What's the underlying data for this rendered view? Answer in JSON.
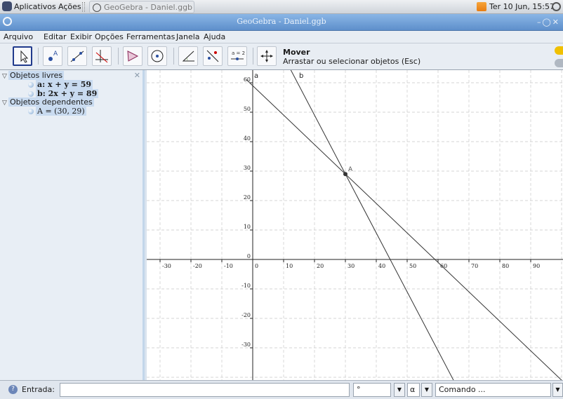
{
  "system_bar": {
    "menu_apps": "Aplicativos",
    "menu_actions": "Ações",
    "task_title": "GeoGebra - Daniel.ggb",
    "clock": "Ter 10 Jun, 15:57"
  },
  "window": {
    "title": "GeoGebra - Daniel.ggb"
  },
  "menu": [
    "Arquivo",
    "Editar",
    "Exibir",
    "Opções",
    "Ferramentas",
    "Janela",
    "Ajuda"
  ],
  "toolbar": {
    "mode_title": "Mover",
    "mode_description": "Arrastar ou selecionar objetos (Esc)",
    "slider_tool_text": "a = 2",
    "icons": [
      "move-icon",
      "point-icon",
      "line-icon",
      "perpendicular-icon",
      "polygon-icon",
      "circle-icon",
      "angle-icon",
      "reflect-icon",
      "slider-icon",
      "move-graphics-icon"
    ]
  },
  "algebra": {
    "free_header": "Objetos livres",
    "free_items": [
      "a: x + y = 59",
      "b: 2x + y = 89"
    ],
    "dependent_header": "Objetos dependentes",
    "dependent_items": [
      "A = (30, 29)"
    ]
  },
  "graphics": {
    "x_ticks": [
      "-30",
      "-20",
      "-10",
      "0",
      "10",
      "20",
      "30",
      "40",
      "50",
      "60",
      "70",
      "80",
      "90"
    ],
    "y_ticks": [
      "60",
      "50",
      "40",
      "30",
      "20",
      "10",
      "0",
      "-10",
      "-20",
      "-30"
    ],
    "line_a_label": "a",
    "line_b_label": "b",
    "point_label": "A",
    "point": [
      30,
      29
    ],
    "lines": {
      "a": "x + y = 59",
      "b": "2x + y = 89"
    },
    "line_color": "#333333"
  },
  "input_bar": {
    "label": "Entrada:",
    "value": "",
    "degree_symbol": "°",
    "alpha_symbol": "α",
    "command_placeholder": "Comando ..."
  }
}
